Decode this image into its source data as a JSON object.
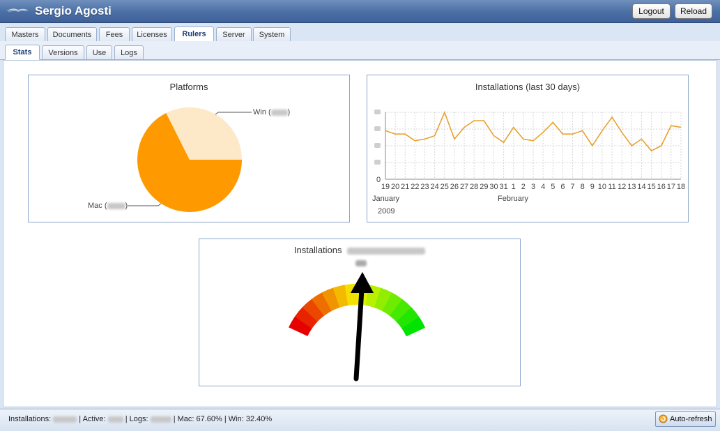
{
  "app": {
    "title": "Sergio Agosti",
    "logout_label": "Logout",
    "reload_label": "Reload"
  },
  "tabs": [
    {
      "label": "Masters"
    },
    {
      "label": "Documents"
    },
    {
      "label": "Fees"
    },
    {
      "label": "Licenses"
    },
    {
      "label": "Rulers",
      "active": true
    },
    {
      "label": "Server"
    },
    {
      "label": "System"
    }
  ],
  "subtabs": [
    {
      "label": "Stats",
      "active": true
    },
    {
      "label": "Versions"
    },
    {
      "label": "Use"
    },
    {
      "label": "Logs"
    }
  ],
  "platforms": {
    "title": "Platforms",
    "win_label": "Win (",
    "mac_label": "Mac (",
    "close_paren": ")"
  },
  "installations30": {
    "title": "Installations (last 30 days)",
    "month1": "January",
    "month2": "February",
    "year": "2009"
  },
  "gauge": {
    "title": "Installations"
  },
  "status": {
    "installations_label": "Installations:",
    "active_label": "| Active:",
    "logs_label": "| Logs:",
    "mac_text": "| Mac: 67.60%",
    "win_text": "| Win: 32.40%"
  },
  "autorefresh_label": "Auto-refresh",
  "colors": {
    "mac": "#ff9900",
    "win": "#fde8c8",
    "line": "#e8a030",
    "accent": "#4a6fa5"
  },
  "chart_data": [
    {
      "type": "pie",
      "title": "Platforms",
      "categories": [
        "Mac",
        "Win"
      ],
      "values": [
        67.6,
        32.4
      ]
    },
    {
      "type": "line",
      "title": "Installations (last 30 days)",
      "x": [
        "19",
        "20",
        "21",
        "22",
        "23",
        "24",
        "25",
        "26",
        "27",
        "28",
        "29",
        "30",
        "31",
        "1",
        "2",
        "3",
        "4",
        "5",
        "6",
        "7",
        "8",
        "9",
        "10",
        "11",
        "12",
        "13",
        "14",
        "15",
        "16",
        "17",
        "18"
      ],
      "series": [
        {
          "values": [
            29,
            27,
            27,
            23,
            24,
            26,
            40,
            24,
            31,
            35,
            35,
            26,
            22,
            31,
            24,
            23,
            28,
            34,
            27,
            27,
            29,
            20,
            29,
            37,
            28,
            20,
            24,
            17,
            20,
            32,
            31
          ]
        }
      ],
      "ylim": [
        0,
        40
      ],
      "grid": true
    }
  ]
}
